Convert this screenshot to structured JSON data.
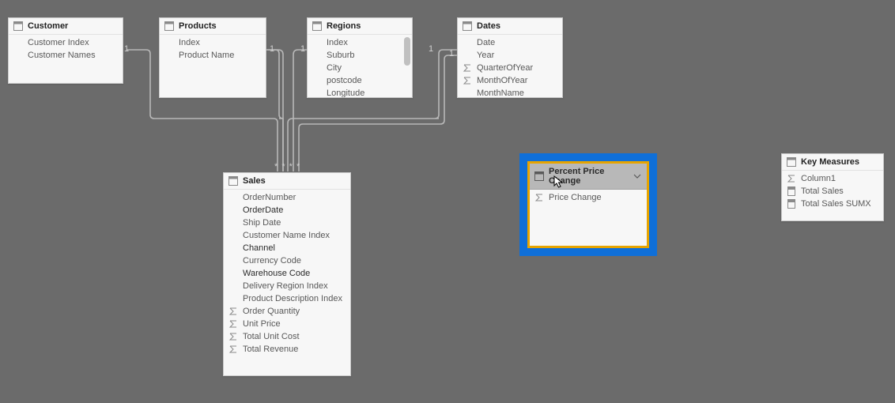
{
  "tables": {
    "customer": {
      "title": "Customer",
      "fields": [
        {
          "label": "Customer Index",
          "icon": "blank",
          "bold": false
        },
        {
          "label": "Customer Names",
          "icon": "blank",
          "bold": false
        }
      ]
    },
    "products": {
      "title": "Products",
      "fields": [
        {
          "label": "Index",
          "icon": "blank",
          "bold": false
        },
        {
          "label": "Product Name",
          "icon": "blank",
          "bold": false
        }
      ]
    },
    "regions": {
      "title": "Regions",
      "fields": [
        {
          "label": "Index",
          "icon": "blank",
          "bold": false
        },
        {
          "label": "Suburb",
          "icon": "blank",
          "bold": false
        },
        {
          "label": "City",
          "icon": "blank",
          "bold": false
        },
        {
          "label": "postcode",
          "icon": "blank",
          "bold": false
        },
        {
          "label": "Longitude",
          "icon": "blank",
          "bold": false
        }
      ]
    },
    "dates": {
      "title": "Dates",
      "fields": [
        {
          "label": "Date",
          "icon": "blank",
          "bold": false
        },
        {
          "label": "Year",
          "icon": "blank",
          "bold": false
        },
        {
          "label": "QuarterOfYear",
          "icon": "sigma",
          "bold": false
        },
        {
          "label": "MonthOfYear",
          "icon": "sigma",
          "bold": false
        },
        {
          "label": "MonthName",
          "icon": "blank",
          "bold": false
        }
      ]
    },
    "sales": {
      "title": "Sales",
      "fields": [
        {
          "label": "OrderNumber",
          "icon": "blank",
          "bold": false
        },
        {
          "label": "OrderDate",
          "icon": "blank",
          "bold": true
        },
        {
          "label": "Ship Date",
          "icon": "blank",
          "bold": false
        },
        {
          "label": "Customer Name Index",
          "icon": "blank",
          "bold": false
        },
        {
          "label": "Channel",
          "icon": "blank",
          "bold": true
        },
        {
          "label": "Currency Code",
          "icon": "blank",
          "bold": false
        },
        {
          "label": "Warehouse Code",
          "icon": "blank",
          "bold": true
        },
        {
          "label": "Delivery Region Index",
          "icon": "blank",
          "bold": false
        },
        {
          "label": "Product Description Index",
          "icon": "blank",
          "bold": false
        },
        {
          "label": "Order Quantity",
          "icon": "sigma",
          "bold": false
        },
        {
          "label": "Unit Price",
          "icon": "sigma",
          "bold": false
        },
        {
          "label": "Total Unit Cost",
          "icon": "sigma",
          "bold": false
        },
        {
          "label": "Total Revenue",
          "icon": "sigma",
          "bold": false
        }
      ]
    },
    "percentPriceChange": {
      "title": "Percent Price Change",
      "fields": [
        {
          "label": "Price Change",
          "icon": "sigma",
          "bold": false
        }
      ]
    },
    "keyMeasures": {
      "title": "Key Measures",
      "fields": [
        {
          "label": "Column1",
          "icon": "sigma",
          "bold": false
        },
        {
          "label": "Total Sales",
          "icon": "table",
          "bold": false
        },
        {
          "label": "Total Sales SUMX",
          "icon": "table",
          "bold": false
        }
      ]
    }
  },
  "relationships": {
    "cardinality_one": "1",
    "cardinality_many": "* * * *"
  }
}
